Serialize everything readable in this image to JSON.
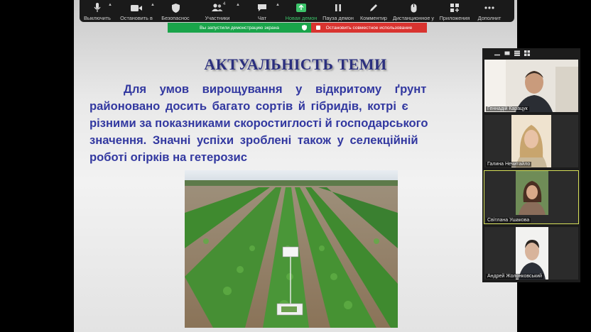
{
  "toolbar": {
    "items": [
      {
        "label": "Выключить",
        "icon": "microphone-icon"
      },
      {
        "label": "Остановить в",
        "icon": "video-camera-icon"
      },
      {
        "label": "Безопаснос",
        "icon": "shield-icon"
      },
      {
        "label": "Участники",
        "icon": "participants-icon",
        "count": "4"
      },
      {
        "label": "Чат",
        "icon": "chat-icon"
      },
      {
        "label": "Новая демон",
        "icon": "share-screen-icon"
      },
      {
        "label": "Пауза демон",
        "icon": "pause-icon"
      },
      {
        "label": "Комментир",
        "icon": "pencil-icon"
      },
      {
        "label": "Дистанционное у",
        "icon": "remote-control-icon"
      },
      {
        "label": "Приложения",
        "icon": "apps-icon"
      },
      {
        "label": "Дополнит",
        "icon": "more-icon"
      }
    ]
  },
  "share_banner": {
    "message": "Вы запустили демонстрацию экрана",
    "stop_label": "Остановить совместное использование"
  },
  "slide": {
    "title": "АКТУАЛЬНІСТЬ ТЕМИ",
    "body_lines": [
      "Для умов вирощування у відкритому ґрунт",
      "районовано досить багато сортів й гібридів, котрі є",
      "різними за показниками скоростиглості й господарського",
      "значення. Значні успіхи зроблені також у селекційній",
      "роботі огірків на гетерозис"
    ]
  },
  "participants": [
    {
      "name": "Геннадій Карацук"
    },
    {
      "name": "Галина Нечитайло"
    },
    {
      "name": "Світлана Ушакова"
    },
    {
      "name": "Андрей Жолонковський"
    }
  ],
  "colors": {
    "title": "#2b2f7e",
    "body": "#3238a0",
    "toolbar_bg": "#1a1a1a",
    "active_green": "#3cc46a",
    "banner_green": "#19a44a",
    "banner_red": "#d9332f",
    "speaker_outline": "#d7e05a"
  }
}
